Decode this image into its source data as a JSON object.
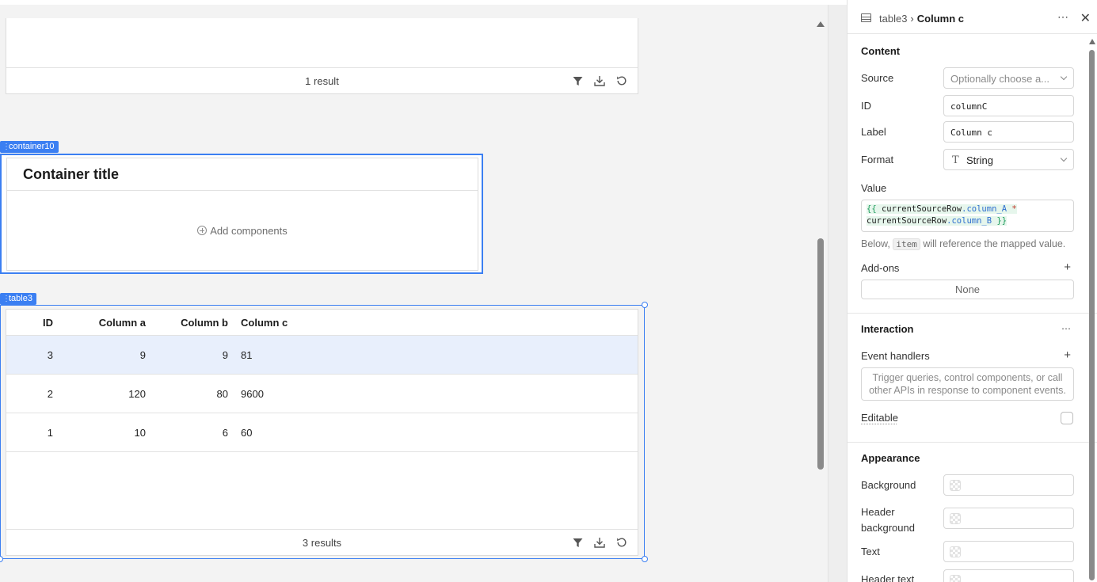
{
  "canvas": {
    "top_table": {
      "footer_count": "1 result"
    },
    "container10": {
      "tag": "container10",
      "title": "Container title",
      "add_label": "Add components"
    },
    "table3": {
      "tag": "table3",
      "columns": [
        "ID",
        "Column a",
        "Column b",
        "Column c"
      ],
      "rows": [
        {
          "id": "3",
          "a": "9",
          "b": "9",
          "c": "81",
          "selected": true
        },
        {
          "id": "2",
          "a": "120",
          "b": "80",
          "c": "9600",
          "selected": false
        },
        {
          "id": "1",
          "a": "10",
          "b": "6",
          "c": "60",
          "selected": false
        }
      ],
      "footer_count": "3 results"
    }
  },
  "panel": {
    "breadcrumb_parent": "table3",
    "breadcrumb_sep": "›",
    "breadcrumb_current": "Column c",
    "more_icon": "⋯",
    "close_icon": "✕",
    "content": {
      "title": "Content",
      "source_label": "Source",
      "source_placeholder": "Optionally choose a...",
      "id_label": "ID",
      "id_value": "columnC",
      "label_label": "Label",
      "label_value": "Column c",
      "format_label": "Format",
      "format_icon": "T",
      "format_value": "String",
      "value_label": "Value",
      "value_code": {
        "open": "{{",
        "obj1": "currentSourceRow",
        "prop1": ".column_A",
        "op": "*",
        "obj2": "currentSourceRow",
        "prop2": ".column_B",
        "close": "}}"
      },
      "hint_before": "Below,",
      "hint_code": "item",
      "hint_after": "will reference the mapped value.",
      "addons_label": "Add-ons",
      "addons_value": "None"
    },
    "interaction": {
      "title": "Interaction",
      "event_handlers_label": "Event handlers",
      "event_handlers_placeholder": "Trigger queries, control components, or call other APIs in response to component events.",
      "editable_label": "Editable"
    },
    "appearance": {
      "title": "Appearance",
      "background_label": "Background",
      "header_bg_label_line1": "Header",
      "header_bg_label_line2": "background",
      "text_label": "Text",
      "header_text_label": "Header text"
    }
  }
}
